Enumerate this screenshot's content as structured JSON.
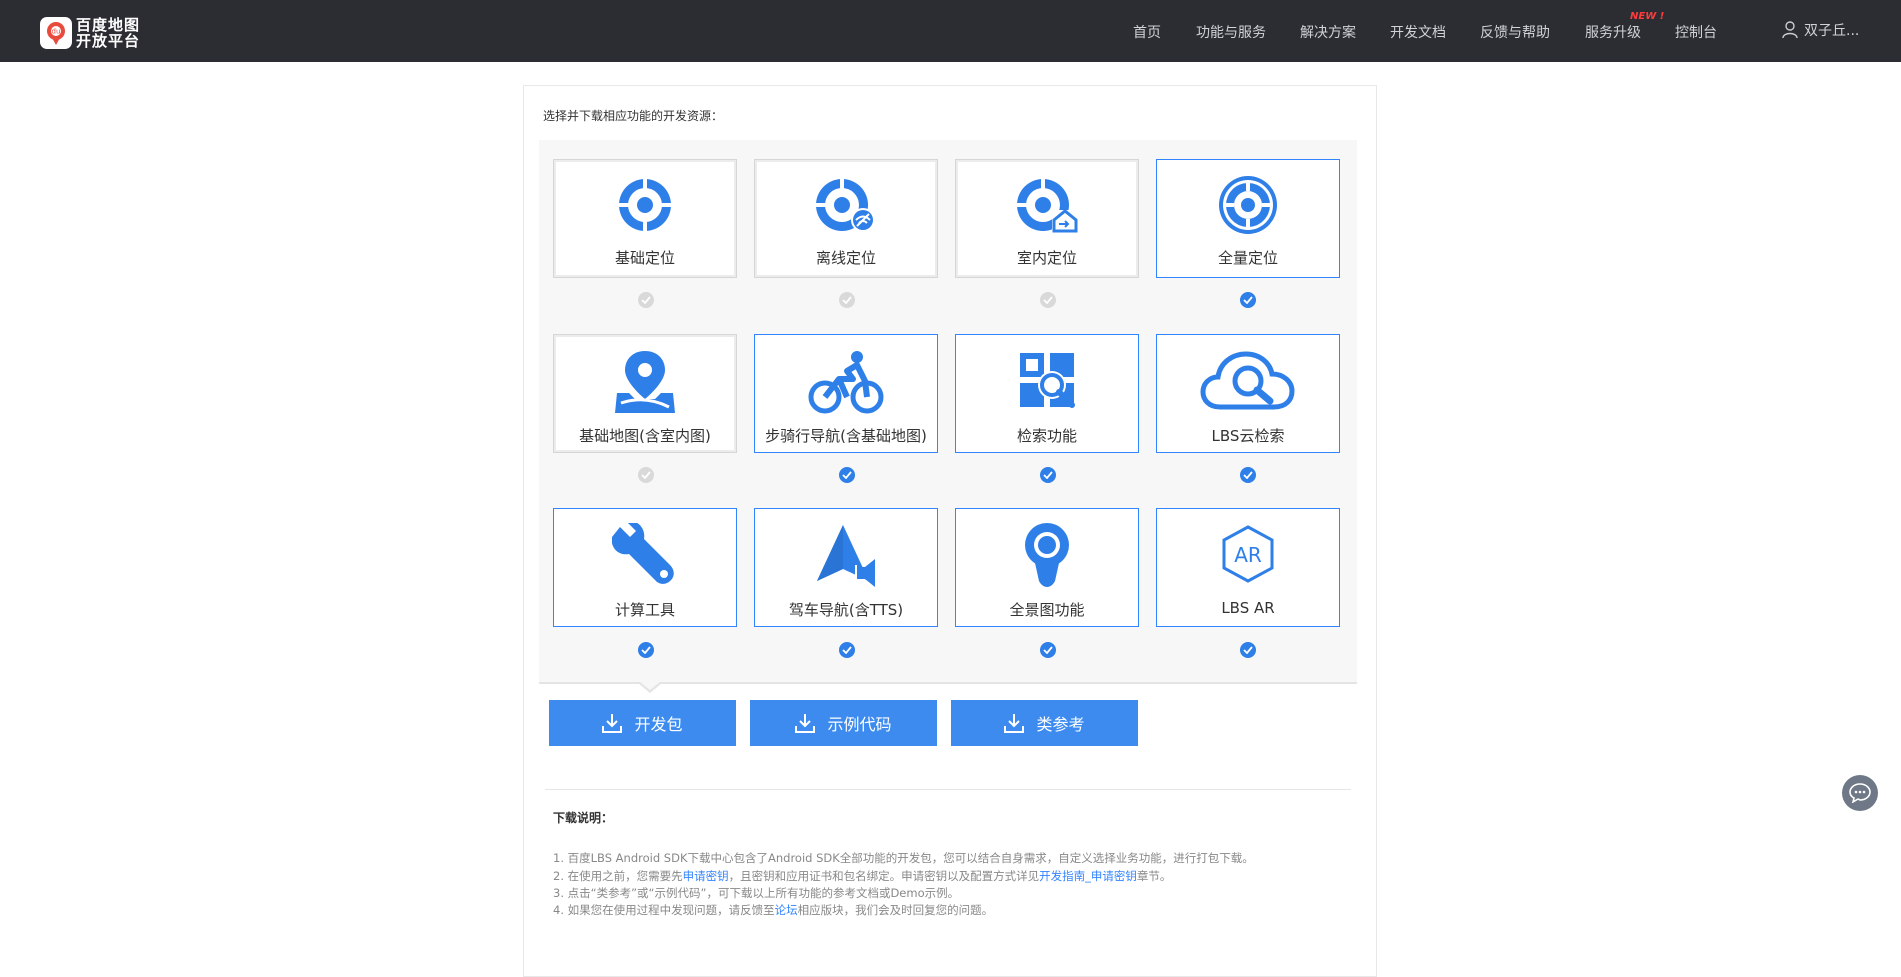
{
  "header": {
    "logo_text": "百度地图开放平台",
    "logo_badge": "du",
    "nav": [
      {
        "label": "首页"
      },
      {
        "label": "功能与服务"
      },
      {
        "label": "解决方案"
      },
      {
        "label": "开发文档"
      },
      {
        "label": "反馈与帮助"
      },
      {
        "label": "服务升级"
      },
      {
        "label": "控制台"
      }
    ],
    "new_badge": "NEW !",
    "user_name": "双子丘..."
  },
  "main": {
    "intro": "选择并下载相应功能的开发资源：",
    "modules": [
      {
        "label": "基础定位",
        "icon": "locate-icon",
        "selected": false
      },
      {
        "label": "离线定位",
        "icon": "offline-locate-icon",
        "selected": false
      },
      {
        "label": "室内定位",
        "icon": "indoor-locate-icon",
        "selected": false
      },
      {
        "label": "全量定位",
        "icon": "full-locate-icon",
        "selected": true
      },
      {
        "label": "基础地图(含室内图)",
        "icon": "map-pin-icon",
        "selected": false
      },
      {
        "label": "步骑行导航(含基础地图)",
        "icon": "cycling-icon",
        "selected": true
      },
      {
        "label": "检索功能",
        "icon": "search-grid-icon",
        "selected": true
      },
      {
        "label": "LBS云检索",
        "icon": "cloud-search-icon",
        "selected": true
      },
      {
        "label": "计算工具",
        "icon": "wrench-icon",
        "selected": true
      },
      {
        "label": "驾车导航(含TTS)",
        "icon": "nav-arrow-icon",
        "selected": true
      },
      {
        "label": "全景图功能",
        "icon": "panorama-icon",
        "selected": true
      },
      {
        "label": "LBS AR",
        "icon": "ar-icon",
        "selected": true
      }
    ],
    "buttons": [
      {
        "label": "开发包"
      },
      {
        "label": "示例代码"
      },
      {
        "label": "类参考"
      }
    ]
  },
  "notes": {
    "title": "下载说明：",
    "line1": "1. 百度LBS Android SDK下载中心包含了Android SDK全部功能的开发包，您可以结合自身需求，自定义选择业务功能，进行打包下载。",
    "line2_a": "2. 在使用之前，您需要先",
    "line2_link1": "申请密钥",
    "line2_b": "，且密钥和应用证书和包名绑定。申请密钥以及配置方式详见",
    "line2_link2": "开发指南_申请密钥",
    "line2_c": "章节。",
    "line3": "3. 点击“类参考”或“示例代码”，可下载以上所有功能的参考文档或Demo示例。",
    "line4_a": "4. 如果您在使用过程中发现问题，请反馈至",
    "line4_link": "论坛",
    "line4_b": "相应版块，我们会及时回复您的问题。"
  },
  "colors": {
    "accent": "#3385ff",
    "icon_blue": "#2e7fe8",
    "topbar": "#2b2d33",
    "button": "#3d8bef"
  }
}
